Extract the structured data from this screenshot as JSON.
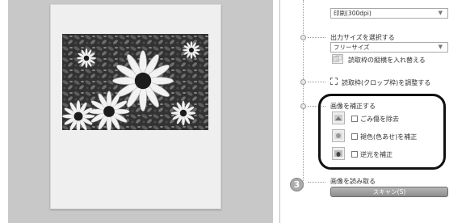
{
  "settings": {
    "resolution_select": "印刷(300dpi)",
    "output_size": {
      "title": "出力サイズを選択する",
      "selected": "フリーサイズ",
      "swap_label": "読取枠の縦横を入れ替える"
    },
    "crop": {
      "label": "読取枠(クロップ枠)を調整する"
    },
    "correction": {
      "title": "画像を補正する",
      "options": [
        {
          "label": "ごみ傷を除去",
          "icon": "dust-removal-icon",
          "checked": false
        },
        {
          "label": "褪色(色あせ)を補正",
          "icon": "fade-correction-icon",
          "checked": false
        },
        {
          "label": "逆光を補正",
          "icon": "backlight-correction-icon",
          "checked": false
        }
      ]
    },
    "scan_step": {
      "number": "3",
      "title": "画像を読み取る",
      "button": "スキャン(S)"
    }
  },
  "colors": {
    "highlight_border": "#111111",
    "button_gray": "#9e9e9e",
    "preview_bg": "#c8c8c8"
  }
}
